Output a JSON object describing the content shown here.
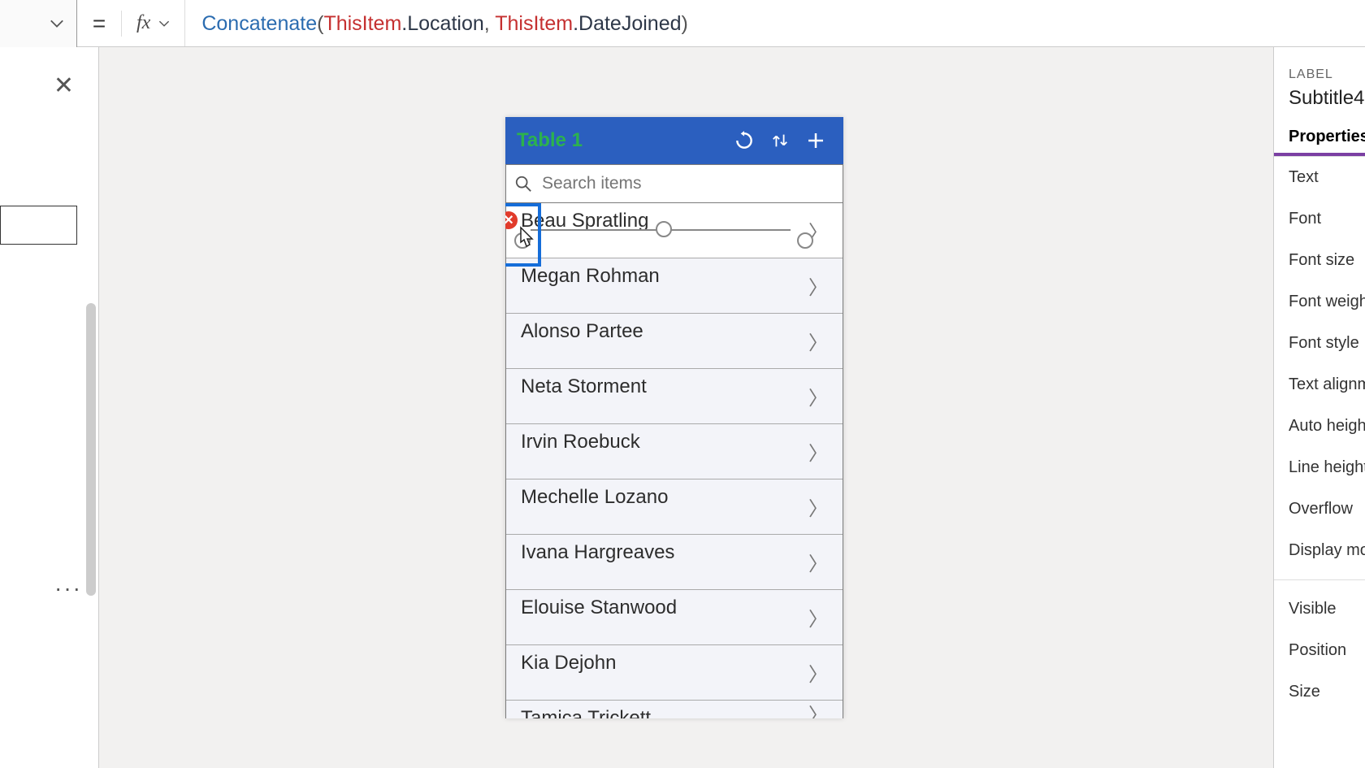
{
  "formula": {
    "func": "Concatenate",
    "this1": "ThisItem",
    "prop1": ".Location",
    "comma": ", ",
    "this2": "ThisItem",
    "prop2": ".DateJoined",
    "close": ")"
  },
  "app": {
    "title": "Table 1",
    "search_placeholder": "Search items",
    "rows": [
      "Beau Spratling",
      "Megan Rohman",
      "Alonso Partee",
      "Neta Storment",
      "Irvin Roebuck",
      "Mechelle Lozano",
      "Ivana Hargreaves",
      "Elouise Stanwood",
      "Kia Dejohn",
      "Tamica Trickett"
    ]
  },
  "right": {
    "label": "LABEL",
    "name": "Subtitle4",
    "tab": "Properties",
    "props": [
      "Text",
      "Font",
      "Font size",
      "Font weight",
      "Font style",
      "Text alignment",
      "Auto height",
      "Line height",
      "Overflow",
      "Display mode"
    ],
    "props2": [
      "Visible",
      "Position",
      "Size"
    ]
  },
  "err_x": "✕",
  "equals": "=",
  "fx": "fx",
  "close_x": "✕",
  "dots": "···"
}
